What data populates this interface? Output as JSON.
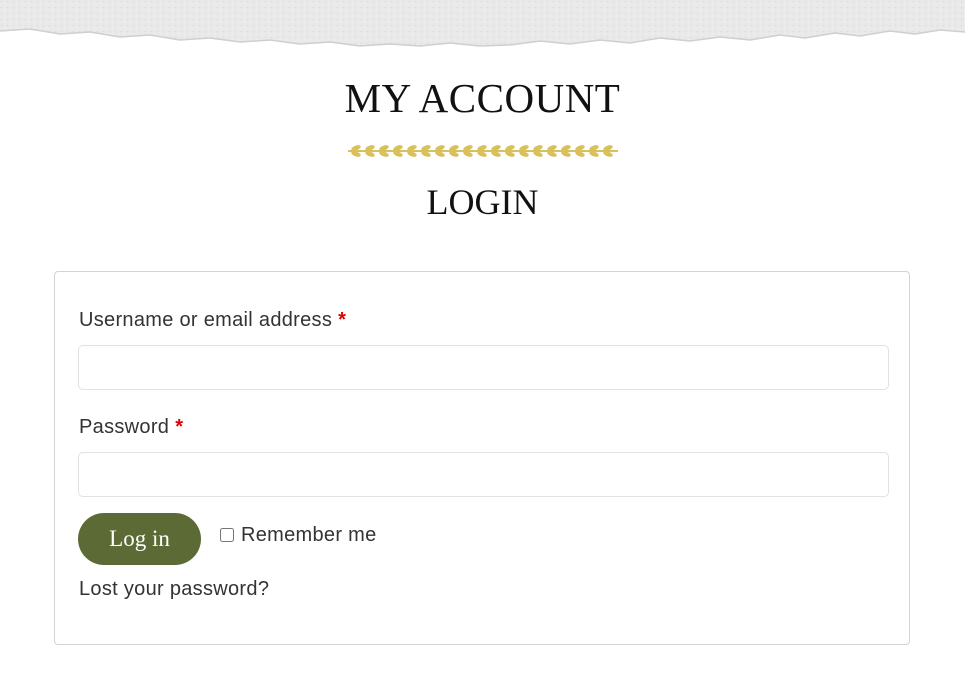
{
  "page": {
    "title": "MY ACCOUNT",
    "section_title": "LOGIN"
  },
  "login_form": {
    "username_label": "Username or email address",
    "password_label": "Password",
    "required_marker": "*",
    "username_value": "",
    "password_value": "",
    "submit_label": "Log in",
    "remember_label": "Remember me",
    "remember_checked": false,
    "lost_password_link": "Lost your password?"
  },
  "icons": {
    "divider": "wheat-divider-icon",
    "header_decoration": "torn-paper-edge"
  },
  "colors": {
    "button_bg": "#5c6b35",
    "required": "#e00000",
    "divider_gold": "#d8c05a"
  }
}
